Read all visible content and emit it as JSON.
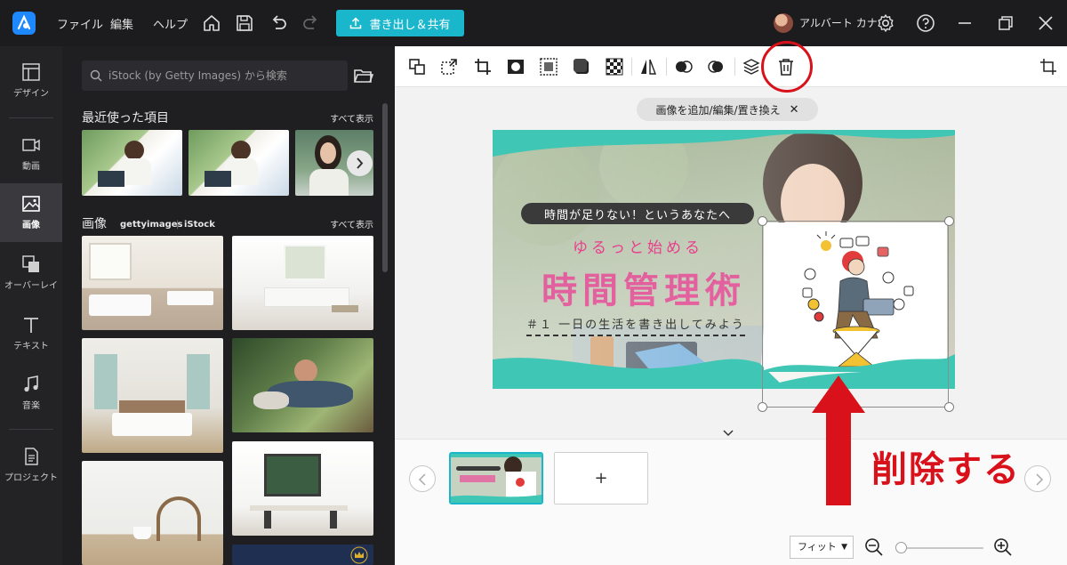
{
  "menu": {
    "file": "ファイル",
    "edit": "編集",
    "help": "ヘルプ"
  },
  "export_label": "書き出し＆共有",
  "user": {
    "name": "アルバート カナ"
  },
  "rail": [
    {
      "label": "デザイン",
      "icon": "design-icon"
    },
    {
      "label": "動画",
      "icon": "video-icon"
    },
    {
      "label": "画像",
      "icon": "image-icon",
      "active": true
    },
    {
      "label": "オーバーレイ",
      "icon": "overlay-icon"
    },
    {
      "label": "テキスト",
      "icon": "text-icon"
    },
    {
      "label": "音楽",
      "icon": "music-icon"
    },
    {
      "label": "プロジェクト",
      "icon": "project-icon"
    }
  ],
  "panel": {
    "search_placeholder": "iStock (by Getty Images) から検索",
    "recent_title": "最近使った項目",
    "images_title": "画像",
    "see_all": "すべて表示",
    "brand_getty": "gettyimages",
    "brand_istock": "iStock"
  },
  "canvas": {
    "chip_label": "画像を追加/編集/置き換え",
    "banner": {
      "pill": "時間が足りない！というあなたへ",
      "tagline": "ゆるっと始める",
      "title": "時間管理術",
      "subtitle": "＃１ 一日の生活を書き出してみよう"
    }
  },
  "timeline": {
    "add_label": "+"
  },
  "zoom": {
    "fit_label": "フィット"
  },
  "annotation": {
    "delete_text": "削除する",
    "color": "#d8111a"
  },
  "colors": {
    "accent": "#1ab7cc",
    "banner_teal": "#3fc6b4",
    "title_pink": "#e83e8c"
  }
}
